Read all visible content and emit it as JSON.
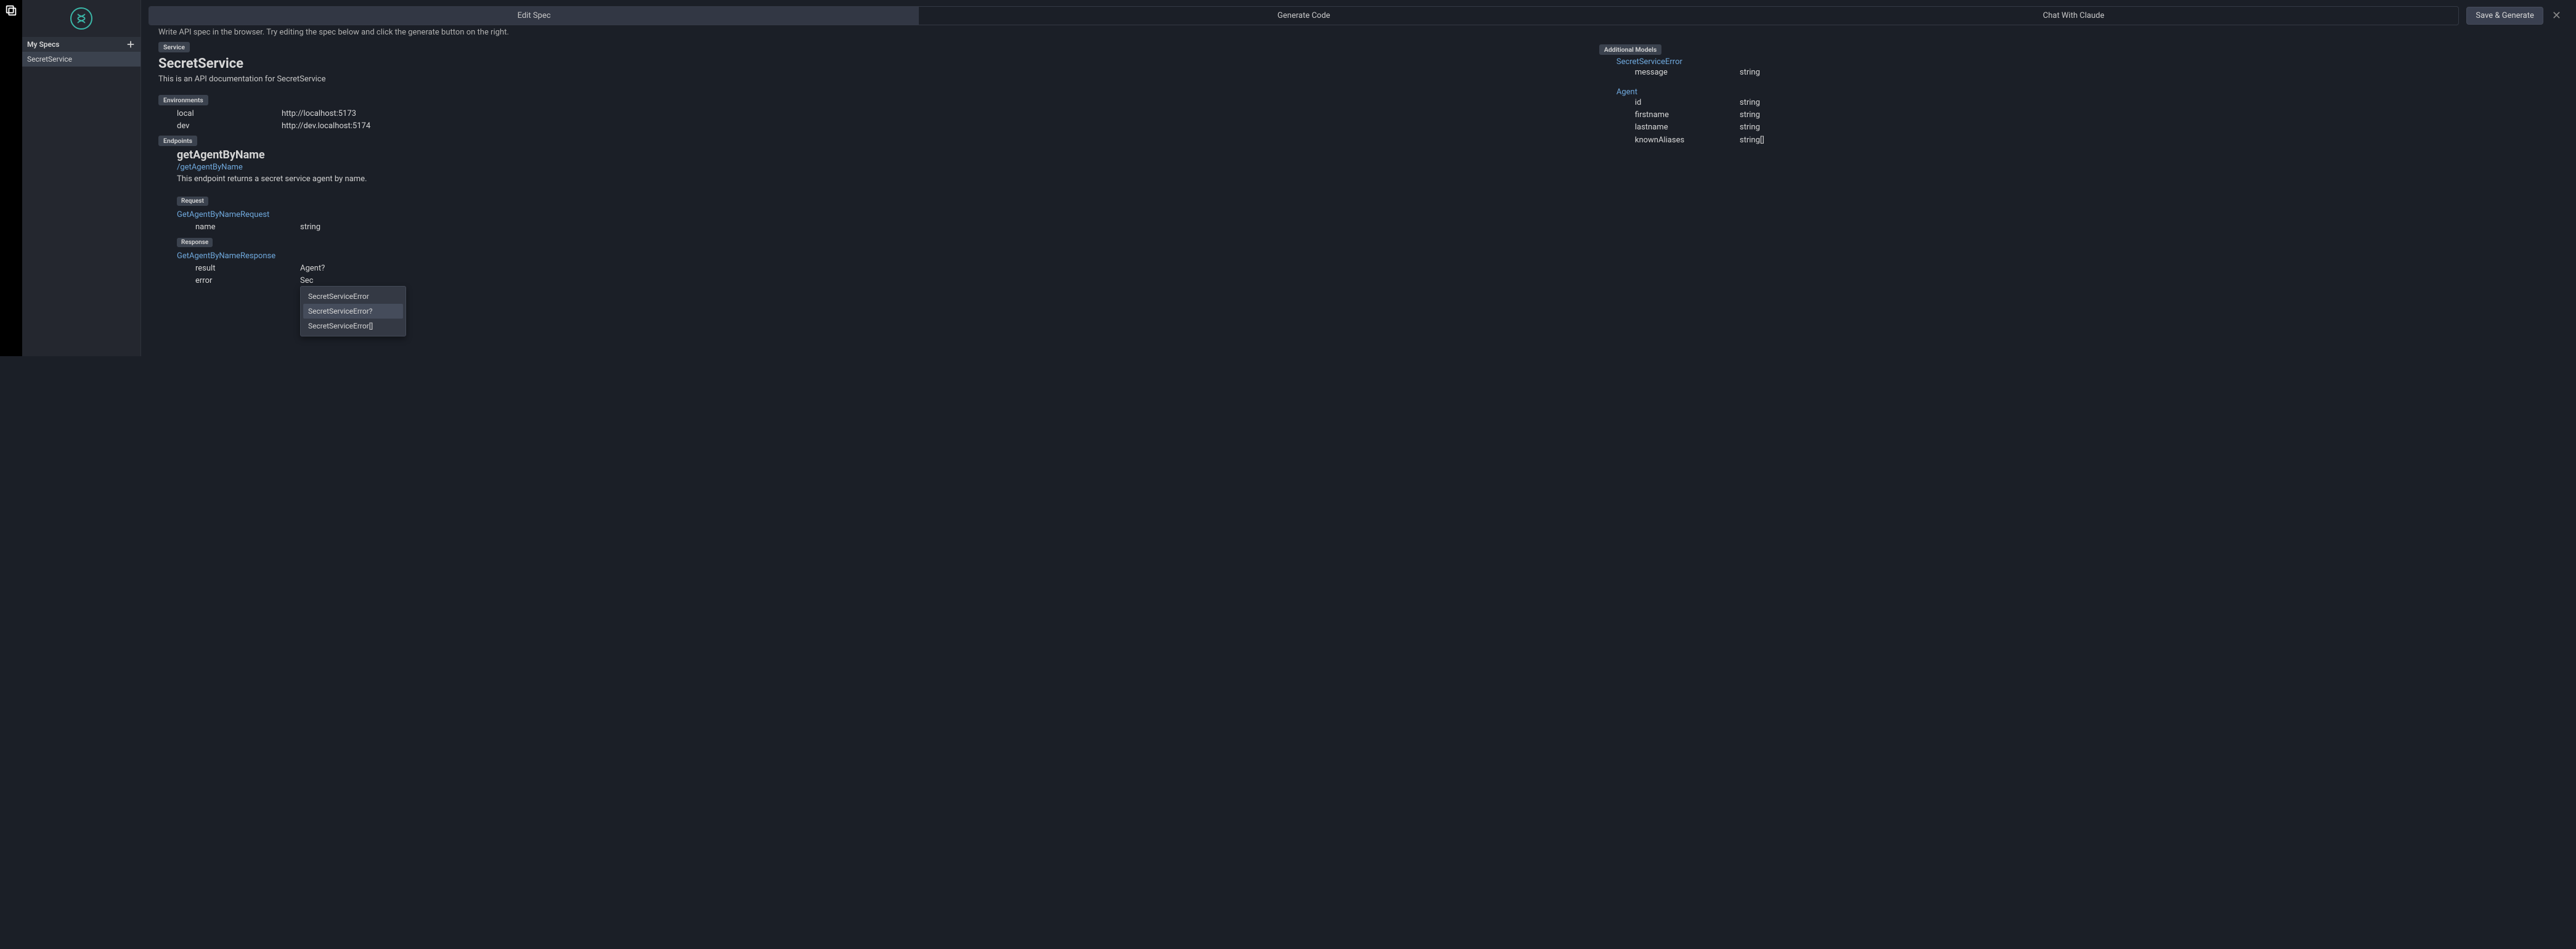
{
  "rail": {
    "icon": "copy-icon"
  },
  "sidebar": {
    "specs_header": "My Specs",
    "items": [
      {
        "label": "SecretService"
      }
    ]
  },
  "tabs": [
    {
      "label": "Edit Spec",
      "active": true
    },
    {
      "label": "Generate Code",
      "active": false
    },
    {
      "label": "Chat With Claude",
      "active": false
    }
  ],
  "save_button": "Save & Generate",
  "instruction": "Write API spec in the browser. Try editing the spec below and click the generate button on the right.",
  "service": {
    "tag": "Service",
    "title": "SecretService",
    "description": "This is an API documentation for SecretService"
  },
  "environments": {
    "tag": "Environments",
    "rows": [
      {
        "name": "local",
        "url": "http://localhost:5173"
      },
      {
        "name": "dev",
        "url": "http://dev.localhost:5174"
      }
    ]
  },
  "endpoints": {
    "tag": "Endpoints",
    "items": [
      {
        "name": "getAgentByName",
        "path": "/getAgentByName",
        "description": "This endpoint returns a secret service agent by name.",
        "request": {
          "tag": "Request",
          "type_name": "GetAgentByNameRequest",
          "fields": [
            {
              "name": "name",
              "type": "string"
            }
          ]
        },
        "response": {
          "tag": "Response",
          "type_name": "GetAgentByNameResponse",
          "fields": [
            {
              "name": "result",
              "type": "Agent?"
            },
            {
              "name": "error",
              "type": "Sec"
            }
          ]
        }
      }
    ]
  },
  "suggestions": [
    {
      "label": "SecretServiceError",
      "highlighted": false
    },
    {
      "label": "SecretServiceError?",
      "highlighted": true
    },
    {
      "label": "SecretServiceError[]",
      "highlighted": false
    }
  ],
  "additional_models": {
    "tag": "Additional Models",
    "models": [
      {
        "name": "SecretServiceError",
        "fields": [
          {
            "name": "message",
            "type": "string"
          }
        ]
      },
      {
        "name": "Agent",
        "fields": [
          {
            "name": "id",
            "type": "string"
          },
          {
            "name": "firstname",
            "type": "string"
          },
          {
            "name": "lastname",
            "type": "string"
          },
          {
            "name": "knownAliases",
            "type": "string[]"
          }
        ]
      }
    ]
  }
}
